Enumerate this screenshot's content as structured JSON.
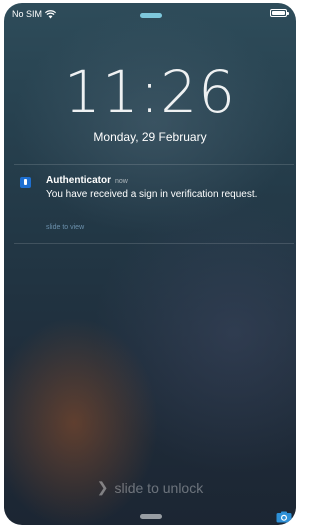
{
  "status_bar": {
    "carrier": "No SIM",
    "wifi_icon": "wifi-icon",
    "battery_icon": "battery-icon"
  },
  "lock_screen": {
    "time": "11:26",
    "date": "Monday, 29 February"
  },
  "notification": {
    "app_icon": "authenticator-app-icon",
    "app_name": "Authenticator",
    "time_ago": "now",
    "message": "You have received a sign in verification request.",
    "action_hint": "slide to view"
  },
  "unlock": {
    "chevron_icon": "chevron-right-icon",
    "label": "slide to unlock"
  },
  "camera_icon": "camera-icon",
  "colors": {
    "accent_grabber": "#7ec8dc",
    "app_icon_blue": "#1e6fd0",
    "camera_blue": "#2d8fd6"
  }
}
